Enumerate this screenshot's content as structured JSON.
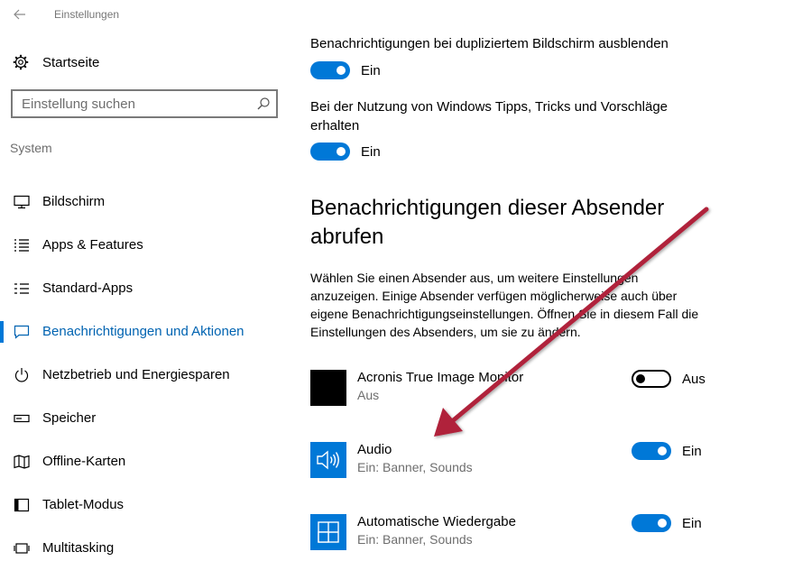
{
  "window": {
    "title": "Einstellungen",
    "back_icon": "arrow-left-icon"
  },
  "sidebar": {
    "home_label": "Startseite",
    "home_icon": "gear-icon",
    "search_placeholder": "Einstellung suchen",
    "search_icon": "search-icon",
    "group_label": "System",
    "items": [
      {
        "label": "Bildschirm",
        "icon": "monitor-icon",
        "active": false
      },
      {
        "label": "Apps & Features",
        "icon": "list-icon",
        "active": false
      },
      {
        "label": "Standard-Apps",
        "icon": "default-apps-icon",
        "active": false
      },
      {
        "label": "Benachrichtigungen und Aktionen",
        "icon": "message-icon",
        "active": true
      },
      {
        "label": "Netzbetrieb und Energiesparen",
        "icon": "power-icon",
        "active": false
      },
      {
        "label": "Speicher",
        "icon": "storage-icon",
        "active": false
      },
      {
        "label": "Offline-Karten",
        "icon": "map-icon",
        "active": false
      },
      {
        "label": "Tablet-Modus",
        "icon": "tablet-icon",
        "active": false
      },
      {
        "label": "Multitasking",
        "icon": "multitasking-icon",
        "active": false
      }
    ]
  },
  "main": {
    "settings": [
      {
        "title": "Benachrichtigungen bei dupliziertem Bildschirm ausblenden",
        "state": "Ein",
        "on": true
      },
      {
        "title": "Bei der Nutzung von Windows Tipps, Tricks und Vorschläge erhalten",
        "state": "Ein",
        "on": true
      }
    ],
    "section_heading": "Benachrichtigungen dieser Absender abrufen",
    "description": "Wählen Sie einen Absender aus, um weitere Einstellungen anzuzeigen. Einige Absender verfügen möglicherweise auch über eigene Benachrichtigungseinstellungen. Öffnen Sie in diesem Fall die Einstellungen des Absenders, um sie zu ändern.",
    "senders": [
      {
        "name": "Acronis True Image Monitor",
        "sub": "Aus",
        "state": "Aus",
        "on": false,
        "tile_color": "#000000",
        "icon": "acronis-icon"
      },
      {
        "name": "Audio",
        "sub": "Ein: Banner, Sounds",
        "state": "Ein",
        "on": true,
        "tile_color": "#0078d7",
        "icon": "speaker-icon"
      },
      {
        "name": "Automatische Wiedergabe",
        "sub": "Ein: Banner, Sounds",
        "state": "Ein",
        "on": true,
        "tile_color": "#0078d7",
        "icon": "autoplay-icon"
      }
    ]
  },
  "colors": {
    "accent": "#0078d7",
    "annotation_arrow": "#b0203a"
  }
}
